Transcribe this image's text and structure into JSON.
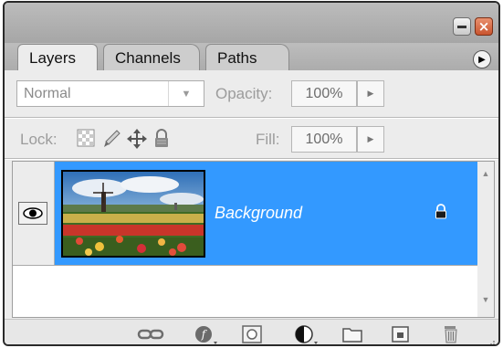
{
  "window": {
    "minimize_icon": "minimize-icon",
    "close_icon": "close-icon",
    "close_glyph": "×",
    "menu_icon": "panel-menu-icon",
    "menu_glyph": "▶"
  },
  "tabs": [
    {
      "label": "Layers",
      "active": true
    },
    {
      "label": "Channels",
      "active": false
    },
    {
      "label": "Paths",
      "active": false
    }
  ],
  "blend_mode": {
    "value": "Normal",
    "arrow": "▼"
  },
  "opacity": {
    "label": "Opacity:",
    "value": "100%",
    "arrow": "▶"
  },
  "lock": {
    "label": "Lock:",
    "icons": [
      "lock-transparent-pixels-icon",
      "lock-image-pixels-icon",
      "lock-position-icon",
      "lock-all-icon"
    ]
  },
  "fill": {
    "label": "Fill:",
    "value": "100%",
    "arrow": "▶"
  },
  "layers": [
    {
      "name": "Background",
      "visible": true,
      "locked": true,
      "selected": true,
      "thumbnail": "tulip-field-with-windmill"
    }
  ],
  "scrollbar": {
    "up": "▲",
    "down": "▼"
  },
  "footer_buttons": [
    "link-layers-icon",
    "layer-style-icon",
    "layer-mask-icon",
    "adjustment-layer-icon",
    "new-group-icon",
    "new-layer-icon",
    "delete-layer-icon"
  ],
  "colors": {
    "selection": "#3399ff",
    "panel_background": "#ececec",
    "titlebar": "#b5b5b5",
    "close_button": "#d56a47"
  }
}
